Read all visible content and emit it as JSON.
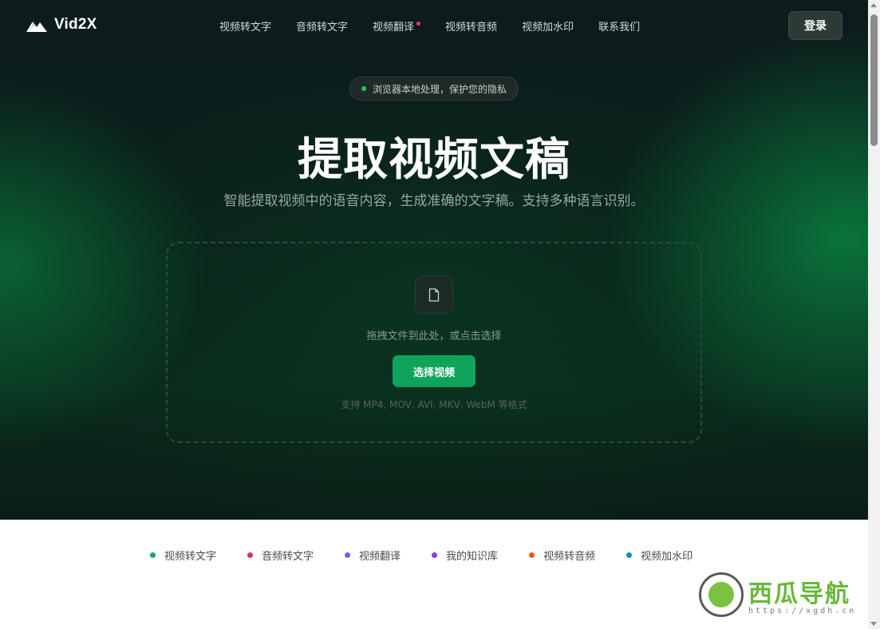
{
  "header": {
    "brand": "Vid2X",
    "nav": [
      {
        "label": "视频转文字"
      },
      {
        "label": "音频转文字"
      },
      {
        "label": "视频翻译",
        "dot": true
      },
      {
        "label": "视频转音频"
      },
      {
        "label": "视频加水印"
      },
      {
        "label": "联系我们"
      }
    ],
    "login_label": "登录"
  },
  "hero": {
    "badge": "浏览器本地处理，保护您的隐私",
    "title": "提取视频文稿",
    "subtitle": "智能提取视频中的语音内容，生成准确的文字稿。支持多种语言识别。"
  },
  "upload": {
    "icon": "file-icon",
    "hint": "拖拽文件到此处，或点击选择",
    "button_label": "选择视频",
    "formats": "支持 MP4, MOV, AVI, MKV, WebM 等格式"
  },
  "features": [
    {
      "label": "视频转文字",
      "color": "#10a66a"
    },
    {
      "label": "音频转文字",
      "color": "#e0305a"
    },
    {
      "label": "视频翻译",
      "color": "#6366f1"
    },
    {
      "label": "我的知识库",
      "color": "#9333ea"
    },
    {
      "label": "视频转音频",
      "color": "#ea580c"
    },
    {
      "label": "视频加水印",
      "color": "#0891b2"
    }
  ],
  "watermark": {
    "name": "西瓜导航",
    "url": "https://xgdh.cn"
  },
  "colors": {
    "accent": "#0fa35b",
    "badge_dot": "#22c55e",
    "nav_dot": "#ef3e5c"
  }
}
